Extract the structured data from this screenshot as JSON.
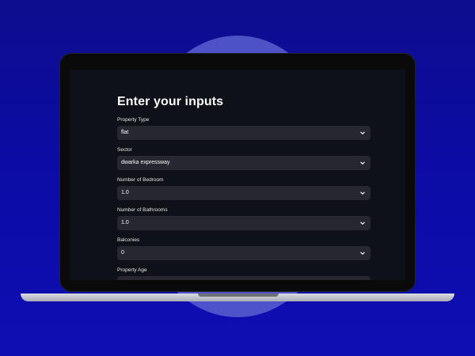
{
  "page": {
    "heading": "Enter your inputs"
  },
  "fields": [
    {
      "label": "Property Type",
      "value": "flat"
    },
    {
      "label": "Sector",
      "value": "dwarka expressway"
    },
    {
      "label": "Number of Bedroom",
      "value": "1.0"
    },
    {
      "label": "Number of Bathrooms",
      "value": "1.0"
    },
    {
      "label": "Balconies",
      "value": "0"
    },
    {
      "label": "Property Age",
      "value": ""
    }
  ],
  "icons": {
    "dropdown": "chevron-down-icon"
  },
  "colors": {
    "background": "#0c0ca6",
    "circle": "#5b5fd0",
    "app_background": "#0e1117",
    "input_background": "#262730",
    "text": "#fafafa"
  }
}
